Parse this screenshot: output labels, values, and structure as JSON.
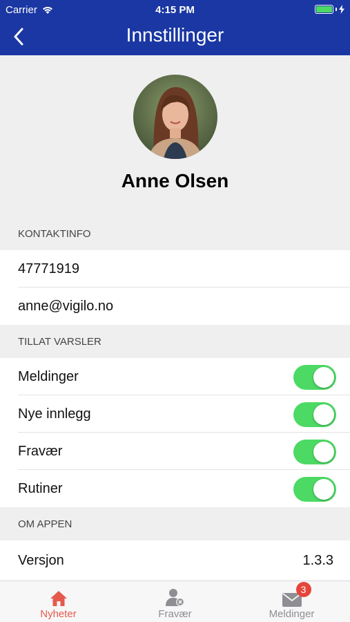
{
  "status_bar": {
    "carrier": "Carrier",
    "time": "4:15 PM"
  },
  "nav": {
    "title": "Innstillinger",
    "back_icon": "chevron-left-icon"
  },
  "profile": {
    "name": "Anne Olsen"
  },
  "contact": {
    "header": "KONTAKTINFO",
    "phone": "47771919",
    "email": "anne@vigilo.no"
  },
  "notifications": {
    "header": "TILLAT VARSLER",
    "items": [
      {
        "label": "Meldinger",
        "enabled": true
      },
      {
        "label": "Nye innlegg",
        "enabled": true
      },
      {
        "label": "Fravær",
        "enabled": true
      },
      {
        "label": "Rutiner",
        "enabled": true
      }
    ]
  },
  "about": {
    "header": "OM APPEN",
    "version_label": "Versjon",
    "version_value": "1.3.3"
  },
  "tabs": [
    {
      "label": "Nyheter",
      "icon": "home-icon",
      "active": true
    },
    {
      "label": "Fravær",
      "icon": "person-absence-icon",
      "active": false
    },
    {
      "label": "Meldinger",
      "icon": "envelope-icon",
      "active": false,
      "badge": "3"
    }
  ],
  "colors": {
    "nav_bg": "#1a37a3",
    "toggle_on": "#4cd964",
    "active_tab": "#e55a4c",
    "badge": "#e5453b"
  }
}
